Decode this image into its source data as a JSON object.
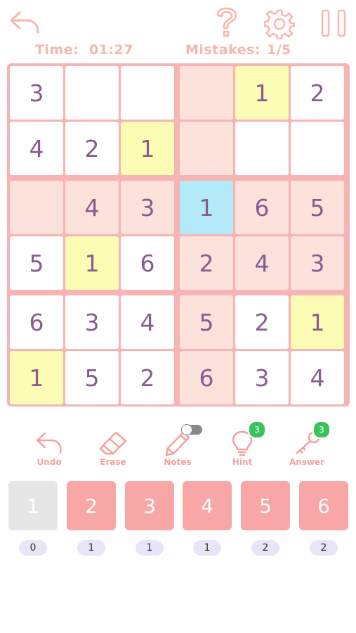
{
  "header": {
    "time_label": "Time:",
    "time_value": "01:27",
    "mistakes_label": "Mistakes:",
    "mistakes_value": "1/5",
    "icons": [
      "back-arrow-icon",
      "help-question-icon",
      "gear-icon",
      "pause-icon"
    ]
  },
  "colors": {
    "accent": "#f6b4b4",
    "digit": "#8a5a90",
    "cell_white": "#ffffff",
    "cell_pink": "#fde2dc",
    "cell_yellow": "#fdfcb4",
    "cell_blue": "#b3eaf9",
    "key_active": "#f9a6a6",
    "key_done": "#e6e6e6",
    "badge": "#3ac35a"
  },
  "board": {
    "size": 6,
    "cells": [
      [
        {
          "v": "3",
          "bg": "white"
        },
        {
          "v": "",
          "bg": "white"
        },
        {
          "v": "",
          "bg": "white"
        },
        {
          "v": "",
          "bg": "pink"
        },
        {
          "v": "1",
          "bg": "yellow"
        },
        {
          "v": "2",
          "bg": "white"
        }
      ],
      [
        {
          "v": "4",
          "bg": "white"
        },
        {
          "v": "2",
          "bg": "white"
        },
        {
          "v": "1",
          "bg": "yellow"
        },
        {
          "v": "",
          "bg": "pink"
        },
        {
          "v": "",
          "bg": "white"
        },
        {
          "v": "",
          "bg": "white"
        }
      ],
      [
        {
          "v": "",
          "bg": "pink"
        },
        {
          "v": "4",
          "bg": "pink"
        },
        {
          "v": "3",
          "bg": "pink"
        },
        {
          "v": "1",
          "bg": "blue"
        },
        {
          "v": "6",
          "bg": "pink"
        },
        {
          "v": "5",
          "bg": "pink"
        }
      ],
      [
        {
          "v": "5",
          "bg": "white"
        },
        {
          "v": "1",
          "bg": "yellow"
        },
        {
          "v": "6",
          "bg": "white"
        },
        {
          "v": "2",
          "bg": "pink"
        },
        {
          "v": "4",
          "bg": "pink"
        },
        {
          "v": "3",
          "bg": "pink"
        }
      ],
      [
        {
          "v": "6",
          "bg": "white"
        },
        {
          "v": "3",
          "bg": "white"
        },
        {
          "v": "4",
          "bg": "white"
        },
        {
          "v": "5",
          "bg": "pink"
        },
        {
          "v": "2",
          "bg": "white"
        },
        {
          "v": "1",
          "bg": "yellow"
        }
      ],
      [
        {
          "v": "1",
          "bg": "yellow"
        },
        {
          "v": "5",
          "bg": "white"
        },
        {
          "v": "2",
          "bg": "white"
        },
        {
          "v": "6",
          "bg": "pink"
        },
        {
          "v": "3",
          "bg": "white"
        },
        {
          "v": "4",
          "bg": "white"
        }
      ]
    ]
  },
  "tools": {
    "undo": {
      "label": "Undo",
      "icon": "undo-arrow-icon"
    },
    "erase": {
      "label": "Erase",
      "icon": "eraser-icon"
    },
    "notes": {
      "label": "Notes",
      "icon": "pencil-icon",
      "toggle_on": false
    },
    "hint": {
      "label": "Hint",
      "icon": "lightbulb-icon",
      "badge": "3"
    },
    "answer": {
      "label": "Answer",
      "icon": "key-icon",
      "badge": "3"
    }
  },
  "numpad": {
    "keys": [
      {
        "digit": "1",
        "count": "0",
        "done": true
      },
      {
        "digit": "2",
        "count": "1",
        "done": false
      },
      {
        "digit": "3",
        "count": "1",
        "done": false
      },
      {
        "digit": "4",
        "count": "1",
        "done": false
      },
      {
        "digit": "5",
        "count": "2",
        "done": false
      },
      {
        "digit": "6",
        "count": "2",
        "done": false
      }
    ]
  }
}
